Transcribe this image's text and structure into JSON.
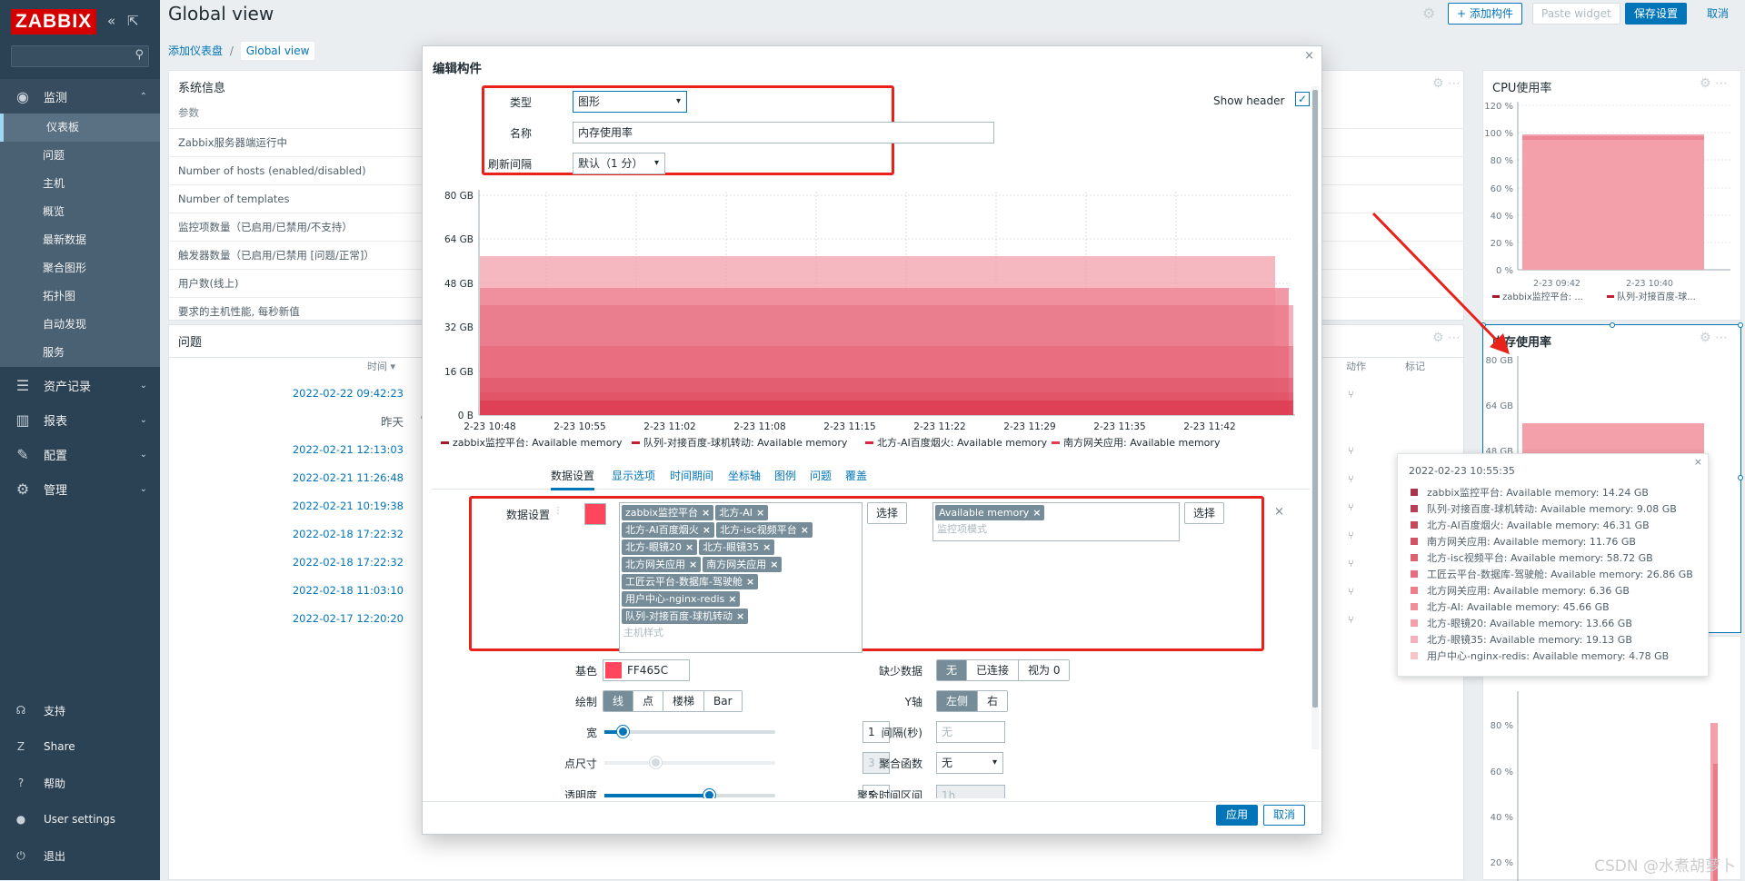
{
  "sidebar": {
    "logo": "ZABBIX",
    "collapse_icon": "«",
    "fullscreen_icon": "⇱",
    "search_icon": "⚲",
    "sections": [
      {
        "icon": "eye-icon",
        "glyph": "◉",
        "label": "监测",
        "expanded": true
      },
      {
        "icon": "list-icon",
        "glyph": "☰",
        "label": "资产记录"
      },
      {
        "icon": "chart-icon",
        "glyph": "▥",
        "label": "报表"
      },
      {
        "icon": "wrench-icon",
        "glyph": "✎",
        "label": "配置"
      },
      {
        "icon": "gear-icon",
        "glyph": "⚙",
        "label": "管理"
      }
    ],
    "monitor_items": [
      "仪表板",
      "问题",
      "主机",
      "概览",
      "最新数据",
      "聚合图形",
      "拓扑图",
      "自动发现",
      "服务"
    ],
    "footer": [
      {
        "icon": "headset-icon",
        "glyph": "☊",
        "label": "支持"
      },
      {
        "icon": "share-icon",
        "glyph": "Z",
        "label": "Share"
      },
      {
        "icon": "help-icon",
        "glyph": "?",
        "label": "帮助"
      },
      {
        "icon": "user-icon",
        "glyph": "●",
        "label": "User settings"
      },
      {
        "icon": "power-icon",
        "glyph": "⏻",
        "label": "退出"
      }
    ]
  },
  "header": {
    "title": "Global view",
    "add_widget": "+ 添加构件",
    "paste_widget": "Paste widget",
    "save": "保存设置",
    "cancel": "取消",
    "gear": "⚙"
  },
  "breadcrumb": {
    "parent": "添加仪表盘",
    "sep": "/",
    "current": "Global view"
  },
  "sysinfo": {
    "title": "系统信息",
    "col": "参数",
    "rows": [
      "Zabbix服务器端运行中",
      "Number of hosts (enabled/disabled)",
      "Number of templates",
      "监控项数量（已启用/已禁用/不支持）",
      "触发器数量（已启用/已禁用 [问题/正常]）",
      "用户数(线上)",
      "要求的主机性能, 每秒新值"
    ]
  },
  "problems": {
    "title": "问题",
    "time_col": "时间 ▾",
    "action_col": "动作",
    "tag_col": "标记",
    "rows": [
      "2022-02-22 09:42:23",
      "昨天",
      "2022-02-21 12:13:03",
      "2022-02-21 11:26:48",
      "2022-02-21 10:19:38",
      "2022-02-18 17:22:32",
      "2022-02-18 17:22:32",
      "2022-02-18 11:03:10",
      "2022-02-17 12:20:20"
    ],
    "action_glyph": "⑂"
  },
  "cpu_widget": {
    "title": "CPU使用率",
    "icons": "⚙ ⋯",
    "yticks": [
      "120 %",
      "100 %",
      "80 %",
      "60 %",
      "40 %",
      "20 %",
      "0 %"
    ],
    "xticks": [
      "2-23 09:42",
      "2-23 10:40"
    ],
    "legend": [
      "zabbix监控平台: ...",
      "队列-对接百度-球..."
    ]
  },
  "mem_widget": {
    "title": "内存使用率",
    "yticks": [
      "80 GB",
      "64 GB",
      "48 GB"
    ],
    "bottom_yticks": [
      "80 %",
      "60 %",
      "40 %",
      "20 %"
    ]
  },
  "modal": {
    "title": "编辑构件",
    "close": "×",
    "type_label": "类型",
    "type_value": "图形",
    "show_header": "Show header",
    "name_label": "名称",
    "name_value": "内存使用率",
    "refresh_label": "刷新间隔",
    "refresh_value": "默认（1 分）",
    "chart": {
      "yticks": [
        "80 GB",
        "64 GB",
        "48 GB",
        "32 GB",
        "16 GB",
        "0 B"
      ],
      "xticks": [
        "2-23 10:48",
        "2-23 10:55",
        "2-23 11:02",
        "2-23 11:08",
        "2-23 11:15",
        "2-23 11:22",
        "2-23 11:29",
        "2-23 11:35",
        "2-23 11:42"
      ],
      "legend": [
        {
          "label": "zabbix监控平台: Available memory",
          "color": "#a01a2a"
        },
        {
          "label": "队列-对接百度-球机转动: Available memory",
          "color": "#c21f33"
        },
        {
          "label": "北方-AI百度烟火: Available memory",
          "color": "#d9283d"
        },
        {
          "label": "南方网关应用: Available memory",
          "color": "#e63b4f"
        }
      ]
    },
    "tabs": [
      "数据设置",
      "显示选项",
      "时间期间",
      "坐标轴",
      "图例",
      "问题",
      "覆盖"
    ],
    "ds_label": "数据设置",
    "hosts": [
      "zabbix监控平台",
      "北方-AI",
      "北方-AI百度烟火",
      "北方-isc视频平台",
      "北方-眼镜20",
      "北方-眼镜35",
      "北方网关应用",
      "南方网关应用",
      "工匠云平台-数据库-驾驶舱",
      "用户中心-nginx-redis",
      "队列-对接百度-球机转动"
    ],
    "host_placeholder": "主机样式",
    "select": "选择",
    "item_tag": "Available memory",
    "item_placeholder": "监控项模式",
    "remove": "×",
    "color_label": "基色",
    "color_value": "FF465C",
    "missing_label": "缺少数据",
    "missing_opts": [
      "无",
      "已连接",
      "视为 0"
    ],
    "draw_label": "绘制",
    "draw_opts": [
      "线",
      "点",
      "楼梯",
      "Bar"
    ],
    "yaxis_label": "Y轴",
    "yaxis_opts": [
      "左侧",
      "右"
    ],
    "width_label": "宽",
    "width_value": "1",
    "interval_label": "间隔(秒)",
    "interval_placeholder": "无",
    "point_label": "点尺寸",
    "point_value": "3",
    "agg_label": "聚合函数",
    "agg_value": "无",
    "transp_label": "透明度",
    "transp_value": "5",
    "agg_interval_label": "聚合时间区间",
    "agg_interval_value": "1h",
    "apply": "应用",
    "cancel": "取消",
    "accent": "#0275b8",
    "highlight": "#e8211b"
  },
  "tooltip": {
    "time": "2022-02-23 10:55:35",
    "close": "×",
    "rows": [
      {
        "label": "zabbix监控平台: Available memory: 14.24 GB",
        "color": "#a8334a"
      },
      {
        "label": "队列-对接百度-球机转动: Available memory: 9.08 GB",
        "color": "#b73d54"
      },
      {
        "label": "北方-AI百度烟火: Available memory: 46.31 GB",
        "color": "#c6485d"
      },
      {
        "label": "南方网关应用: Available memory: 11.76 GB",
        "color": "#d35366"
      },
      {
        "label": "北方-isc视频平台: Available memory: 58.72 GB",
        "color": "#de6072"
      },
      {
        "label": "工匠云平台-数据库-驾驶舱: Available memory: 26.86 GB",
        "color": "#e66e7f"
      },
      {
        "label": "北方网关应用: Available memory: 6.36 GB",
        "color": "#ec7e8d"
      },
      {
        "label": "北方-AI: Available memory: 45.66 GB",
        "color": "#f08f9c"
      },
      {
        "label": "北方-眼镜20: Available memory: 13.66 GB",
        "color": "#f3a0ab"
      },
      {
        "label": "北方-眼镜35: Available memory: 19.13 GB",
        "color": "#f5b1ba"
      },
      {
        "label": "用户中心-nginx-redis: Available memory: 4.78 GB",
        "color": "#f7c4ca"
      }
    ]
  },
  "watermark": "CSDN @水煮胡萝卜"
}
